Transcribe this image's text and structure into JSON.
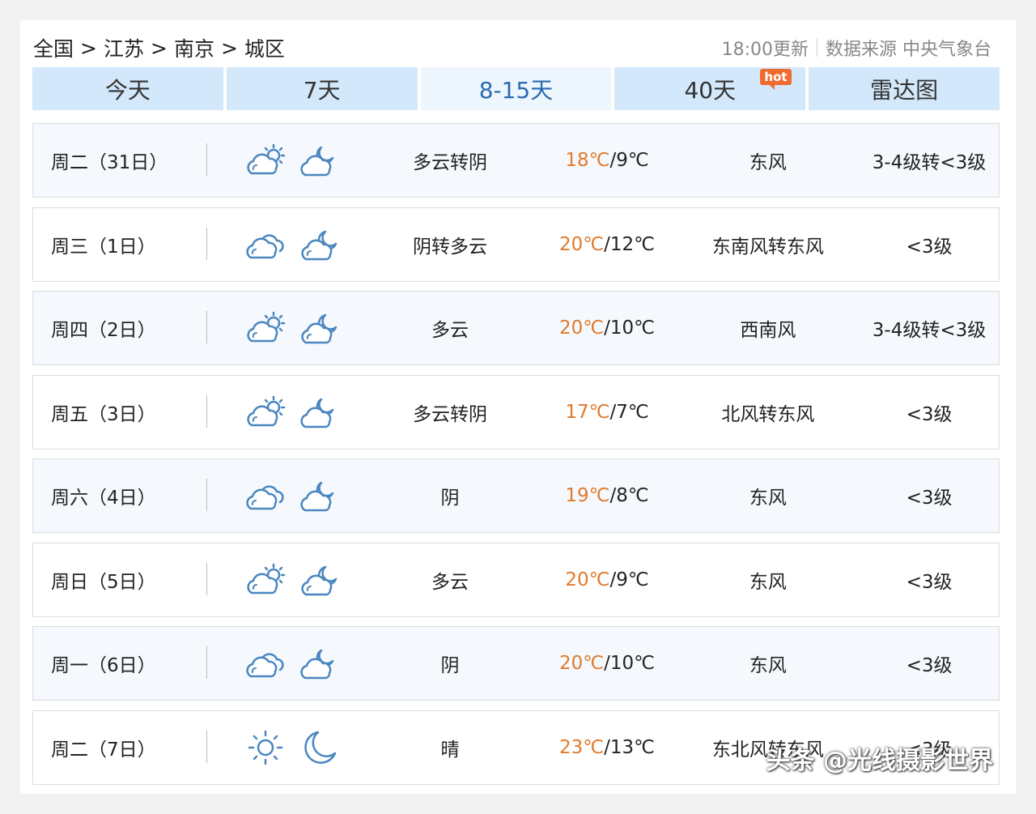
{
  "breadcrumb": {
    "items": [
      "全国",
      "江苏",
      "南京",
      "城区"
    ],
    "separator": ">"
  },
  "update": {
    "time": "18:00更新",
    "source": "数据来源 中央气象台"
  },
  "tabs": [
    {
      "label": "今天",
      "active": false
    },
    {
      "label": "7天",
      "active": false
    },
    {
      "label": "8-15天",
      "active": true
    },
    {
      "label": "40天",
      "active": false,
      "badge": "hot"
    },
    {
      "label": "雷达图",
      "active": false
    }
  ],
  "rows": [
    {
      "date": "周二（31日）",
      "day_icon": "cloud-sun-icon",
      "night_icon": "cloud-moon-icon",
      "weather": "多云转阴",
      "high": "18℃",
      "low": "9℃",
      "wind": "东风",
      "level": "3-4级转<3级"
    },
    {
      "date": "周三（1日）",
      "day_icon": "cloudy-icon",
      "night_icon": "moon-cloud-icon",
      "weather": "阴转多云",
      "high": "20℃",
      "low": "12℃",
      "wind": "东南风转东风",
      "level": "<3级"
    },
    {
      "date": "周四（2日）",
      "day_icon": "cloud-sun-icon",
      "night_icon": "moon-cloud-icon",
      "weather": "多云",
      "high": "20℃",
      "low": "10℃",
      "wind": "西南风",
      "level": "3-4级转<3级"
    },
    {
      "date": "周五（3日）",
      "day_icon": "cloud-sun-icon",
      "night_icon": "cloud-moon-icon",
      "weather": "多云转阴",
      "high": "17℃",
      "low": "7℃",
      "wind": "北风转东风",
      "level": "<3级"
    },
    {
      "date": "周六（4日）",
      "day_icon": "cloudy-icon",
      "night_icon": "cloud-moon-icon",
      "weather": "阴",
      "high": "19℃",
      "low": "8℃",
      "wind": "东风",
      "level": "<3级"
    },
    {
      "date": "周日（5日）",
      "day_icon": "cloud-sun-icon",
      "night_icon": "moon-cloud-icon",
      "weather": "多云",
      "high": "20℃",
      "low": "9℃",
      "wind": "东风",
      "level": "<3级"
    },
    {
      "date": "周一（6日）",
      "day_icon": "cloudy-icon",
      "night_icon": "cloud-moon-icon",
      "weather": "阴",
      "high": "20℃",
      "low": "10℃",
      "wind": "东风",
      "level": "<3级"
    },
    {
      "date": "周二（7日）",
      "day_icon": "sun-icon",
      "night_icon": "moon-icon",
      "weather": "晴",
      "high": "23℃",
      "low": "13℃",
      "wind": "东北风转东风",
      "level": "<3级"
    }
  ],
  "temp_separator": "/",
  "watermark": "头条 @光线摄影世界",
  "colors": {
    "accent": "#2a6bb0",
    "tab_bg": "#d3e8fa",
    "high_temp": "#e07a2c",
    "hot_badge": "#f06b2e",
    "icon_stroke": "#4a86c0"
  }
}
